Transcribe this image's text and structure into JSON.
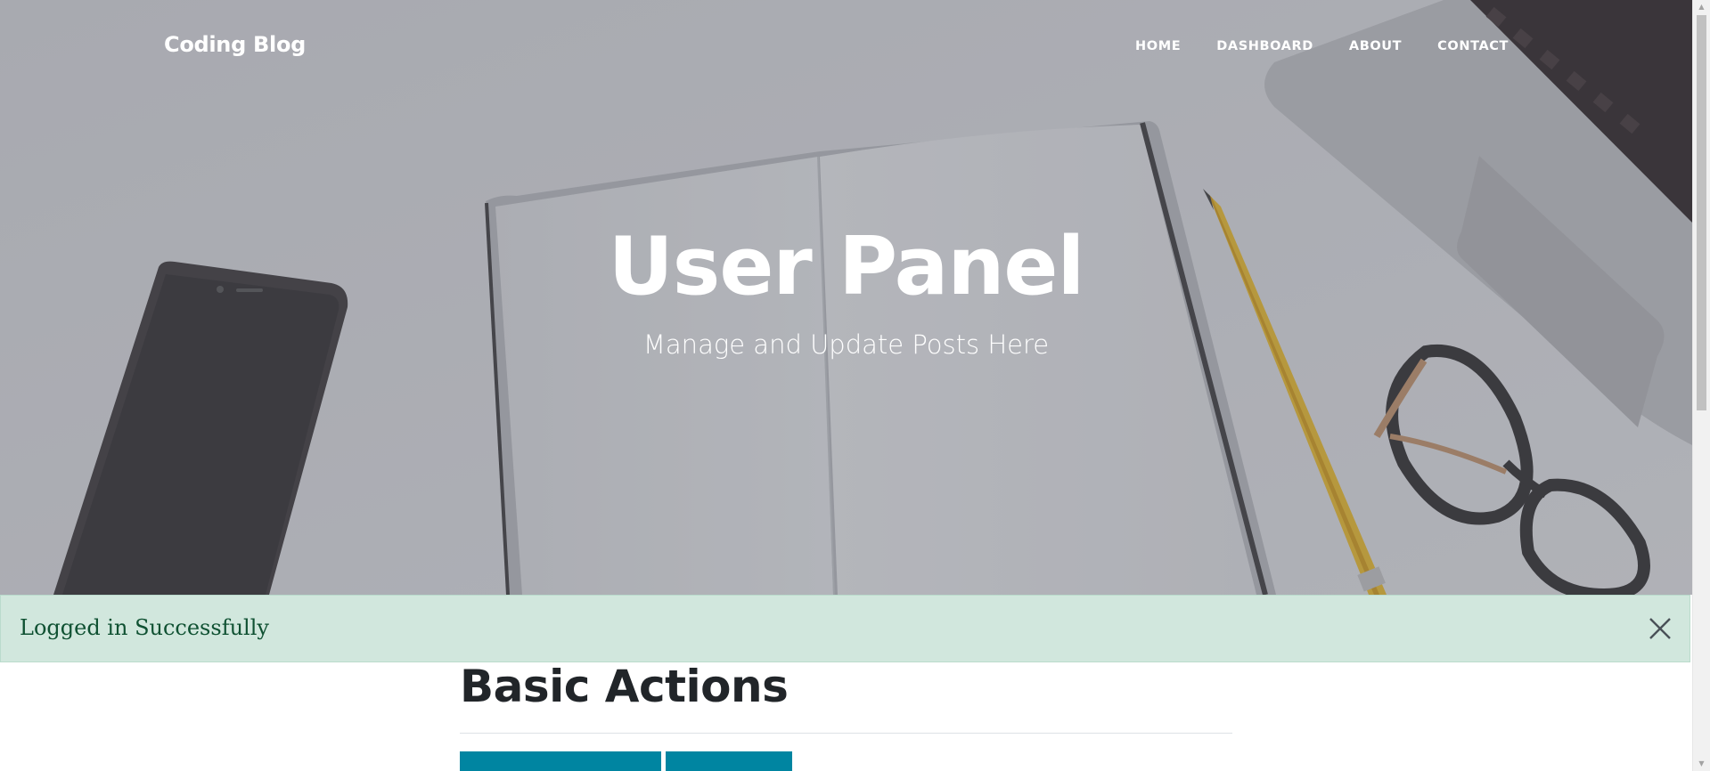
{
  "navbar": {
    "brand": "Coding Blog",
    "links": [
      "HOME",
      "DASHBOARD",
      "ABOUT",
      "CONTACT"
    ]
  },
  "hero": {
    "title": "User Panel",
    "subtitle": "Manage and Update Posts Here",
    "background_image": "desk-with-notebook-phone-pencil-glasses-laptop"
  },
  "alert": {
    "message": "Logged in Successfully",
    "close_icon": "close-icon",
    "colors": {
      "background": "#d1e7dd",
      "text": "#0f5132"
    }
  },
  "content": {
    "section_title": "Basic Actions",
    "buttons": [
      "",
      ""
    ]
  },
  "theme": {
    "accent": "#0085a1",
    "heading_text": "#212529"
  }
}
